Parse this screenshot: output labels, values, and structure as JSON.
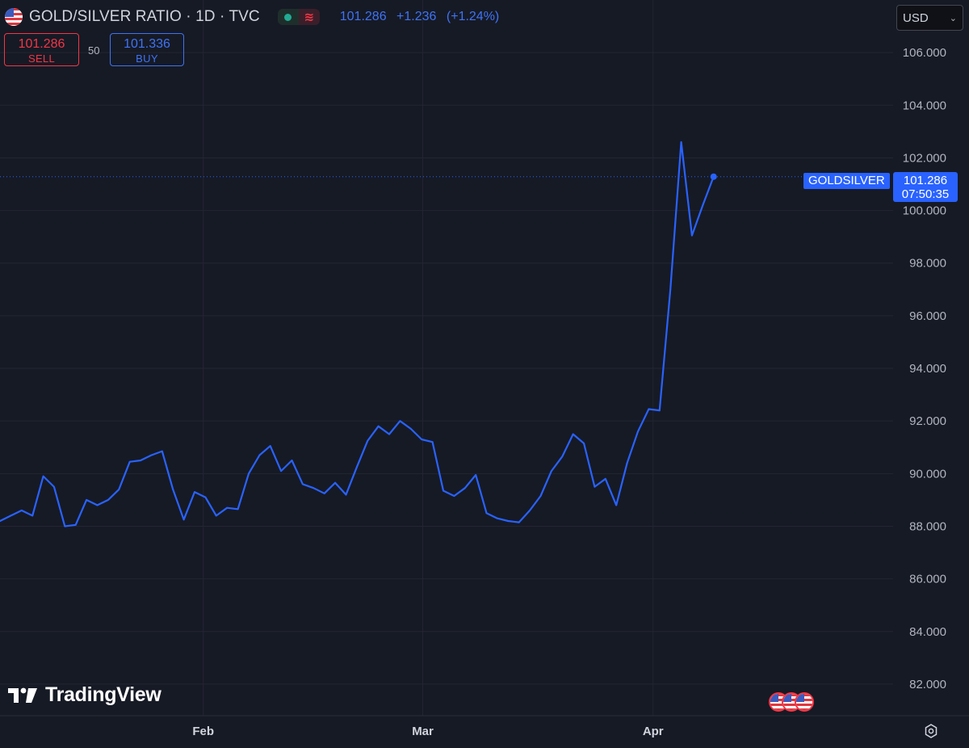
{
  "header": {
    "title": "GOLD/SILVER RATIO · 1D · TVC",
    "last_price": "101.286",
    "change": "+1.236",
    "change_pct": "(+1.24%)",
    "delay_symbol": "≋"
  },
  "trade": {
    "sell_price": "101.286",
    "sell_label": "SELL",
    "spread": "50",
    "buy_price": "101.336",
    "buy_label": "BUY"
  },
  "currency": {
    "value": "USD"
  },
  "price_tag": {
    "symbol": "GOLDSILVER",
    "price": "101.286",
    "countdown": "07:50:35"
  },
  "watermark": "TradingView",
  "icons": {
    "flag": "us-flag-icon",
    "status": "market-open-dot-icon",
    "events": "economic-events-icon",
    "settings": "chart-settings-icon"
  },
  "colors": {
    "background": "#161a25",
    "line": "#2962ff",
    "sell": "#f23645",
    "buy": "#3f73f5",
    "grid": "#232632",
    "text": "#b2b5be"
  },
  "chart_data": {
    "type": "line",
    "title": "GOLD/SILVER RATIO · 1D · TVC",
    "xlabel": "",
    "ylabel": "",
    "ylim": [
      80.8,
      108.0
    ],
    "y_ticks": [
      "106.000",
      "104.000",
      "102.000",
      "100.000",
      "98.000",
      "96.000",
      "94.000",
      "92.000",
      "90.000",
      "88.000",
      "86.000",
      "84.000",
      "82.000"
    ],
    "x_ticks": [
      {
        "label": "Feb",
        "index": 18.8
      },
      {
        "label": "Mar",
        "index": 39.1
      },
      {
        "label": "Apr",
        "index": 60.4
      }
    ],
    "x_range": [
      0,
      82.6
    ],
    "grid": true,
    "series": [
      {
        "values": [
          88.2,
          88.4,
          88.6,
          88.4,
          89.9,
          89.5,
          88.0,
          88.05,
          89.0,
          88.8,
          89.0,
          89.4,
          90.45,
          90.5,
          90.7,
          90.85,
          89.4,
          88.25,
          89.3,
          89.1,
          88.4,
          88.7,
          88.65,
          90.0,
          90.7,
          91.05,
          90.1,
          90.5,
          89.6,
          89.45,
          89.25,
          89.65,
          89.2,
          90.25,
          91.25,
          91.8,
          91.5,
          92.0,
          91.7,
          91.3,
          91.2,
          89.35,
          89.15,
          89.45,
          89.95,
          88.5,
          88.3,
          88.2,
          88.15,
          88.6,
          89.15,
          90.1,
          90.65,
          91.5,
          91.15,
          89.5,
          89.8,
          88.8,
          90.4,
          91.6,
          92.45,
          92.4,
          97.0,
          102.6,
          99.05,
          100.2,
          101.286
        ]
      }
    ],
    "last_value": 101.286
  }
}
